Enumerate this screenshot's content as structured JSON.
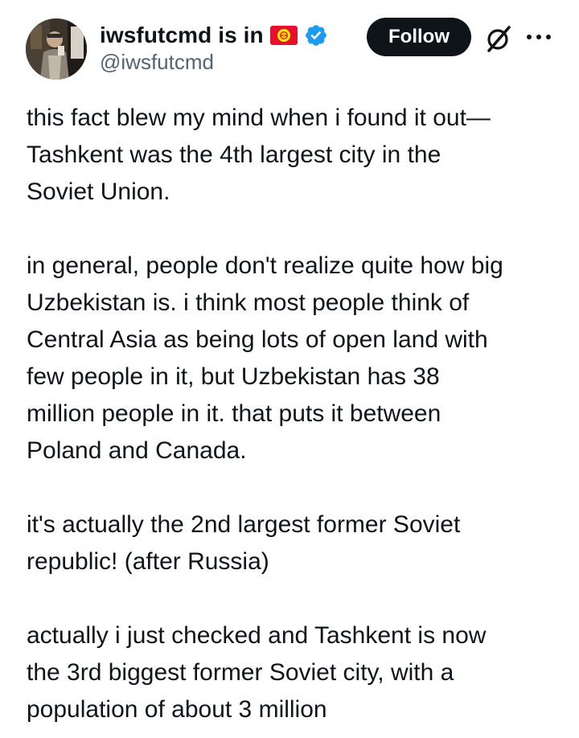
{
  "header": {
    "display_name": "iwsfutcmd is in",
    "handle": "@iwsfutcmd",
    "follow_label": "Follow",
    "flag_icon": "kyrgyzstan-flag-icon",
    "verified_icon": "verified-badge-icon",
    "grok_icon": "grok-icon",
    "more_icon": "more-options-icon"
  },
  "post": {
    "paragraphs": [
      "this fact blew my mind when i found it out—\nTashkent was the 4th largest city in the\nSoviet Union.",
      "in general, people don't realize quite how big\nUzbekistan is. i think most people think of\nCentral Asia as being lots of open land with\nfew people in it, but Uzbekistan has 38\nmillion people in it. that puts it between\nPoland and Canada.",
      "it's actually the 2nd largest former Soviet\nrepublic! (after Russia)",
      "actually i just checked and Tashkent is now\nthe 3rd biggest former Soviet city, with a\npopulation of about 3 million"
    ]
  },
  "colors": {
    "text": "#0f1419",
    "secondary": "#536471",
    "verified": "#1d9bf0",
    "flag_red": "#e8112d",
    "flag_sun": "#ffef00",
    "button_bg": "#0f1419"
  }
}
